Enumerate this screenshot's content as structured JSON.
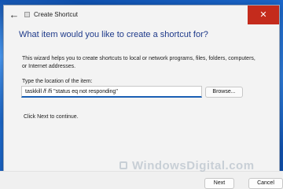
{
  "window": {
    "title": "Create Shortcut",
    "close_glyph": "✕",
    "back_glyph": "←"
  },
  "main": {
    "heading": "What item would you like to create a shortcut for?",
    "description": "This wizard helps you to create shortcuts to local or network programs, files, folders, computers, or Internet addresses.",
    "location_label": "Type the location of the item:",
    "location_value": "taskkill /f /fi \"status eq not responding\"",
    "browse_label": "Browse...",
    "continue_note": "Click Next to continue."
  },
  "footer": {
    "next_label": "Next",
    "cancel_label": "Cancel"
  },
  "watermark": {
    "text": "WindowsDigital.com"
  },
  "colors": {
    "accent": "#1a5fb4",
    "heading": "#1e3a8a",
    "close": "#c42b1c"
  }
}
